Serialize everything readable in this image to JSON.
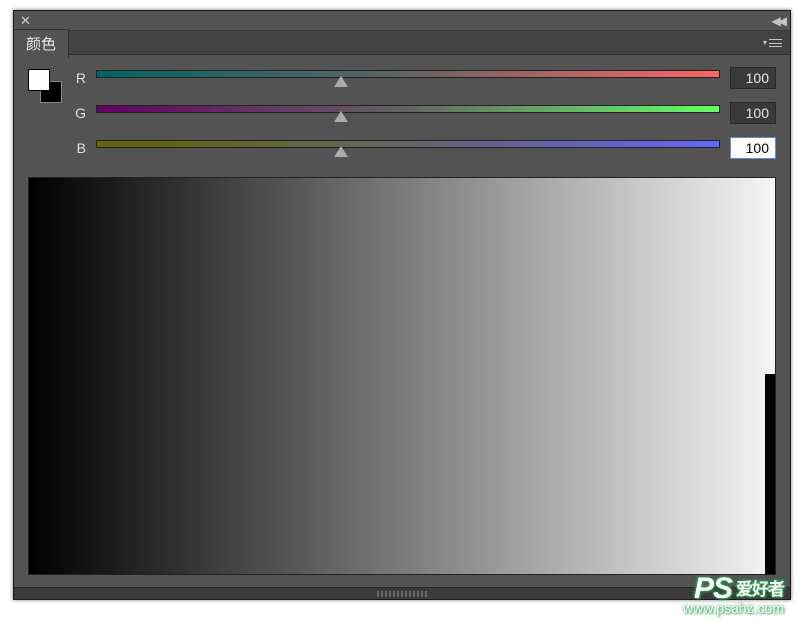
{
  "panel": {
    "title": "颜色"
  },
  "rgb": {
    "r": {
      "label": "R",
      "value": "100"
    },
    "g": {
      "label": "G",
      "value": "100"
    },
    "b": {
      "label": "B",
      "value": "100"
    }
  },
  "watermark": {
    "logo_latin": "PS",
    "logo_cn": "爱好者",
    "url": "www.psahz.com"
  }
}
